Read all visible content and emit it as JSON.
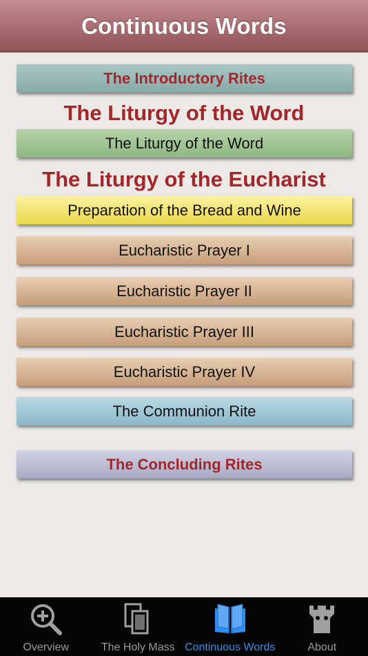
{
  "header": {
    "title": "Continuous Words"
  },
  "sections": {
    "introductory": "The Introductory Rites",
    "word_heading": "The Liturgy of the Word",
    "word_button": "The Liturgy of the Word",
    "eucharist_heading": "The Liturgy of the Eucharist",
    "preparation": "Preparation of the Bread and Wine",
    "prayer1": "Eucharistic Prayer I",
    "prayer2": "Eucharistic Prayer II",
    "prayer3": "Eucharistic Prayer III",
    "prayer4": "Eucharistic Prayer IV",
    "communion": "The Communion Rite",
    "concluding": "The Concluding Rites"
  },
  "tabs": [
    {
      "label": "Overview",
      "icon": "magnifier-plus-icon",
      "active": false
    },
    {
      "label": "The Holy Mass",
      "icon": "stacked-pages-icon",
      "active": false
    },
    {
      "label": "Continuous Words",
      "icon": "open-book-icon",
      "active": true
    },
    {
      "label": "About",
      "icon": "tower-icon",
      "active": false
    }
  ],
  "colors": {
    "accent_red": "#a3262a",
    "tab_active": "#2f8ff0",
    "tab_inactive": "#9a9a9a"
  }
}
